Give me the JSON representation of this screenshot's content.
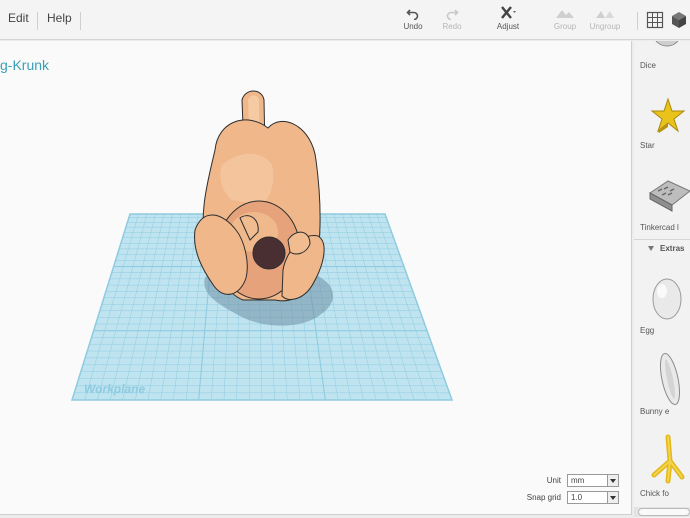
{
  "menu": {
    "edit": "Edit",
    "help": "Help"
  },
  "toolbar": {
    "undo": "Undo",
    "redo": "Redo",
    "adjust": "Adjust",
    "group": "Group",
    "ungroup": "Ungroup"
  },
  "canvas": {
    "design_title": "g-Krunk",
    "workplane_label": "Workplane"
  },
  "settings": {
    "unit_label": "Unit",
    "unit_value": "mm",
    "snap_label": "Snap grid",
    "snap_value": "1.0"
  },
  "panel": {
    "shapes_top": [
      {
        "label": "Dice",
        "icon": "dice-icon"
      },
      {
        "label": "Star",
        "icon": "star-icon"
      },
      {
        "label": "Tinkercad l",
        "icon": "tinkercad-logo-icon"
      }
    ],
    "extras_title": "Extras",
    "extras": [
      {
        "label": "Egg",
        "icon": "egg-icon"
      },
      {
        "label": "Bunny e",
        "icon": "bunny-ear-icon"
      },
      {
        "label": "Chick fo",
        "icon": "chick-foot-icon"
      }
    ]
  },
  "colors": {
    "accent": "#39a0b3",
    "workplane": "#bfe4f0",
    "grid": "#8ecbe0",
    "model_skin": "#f0b98c",
    "star": "#e9c21c"
  }
}
